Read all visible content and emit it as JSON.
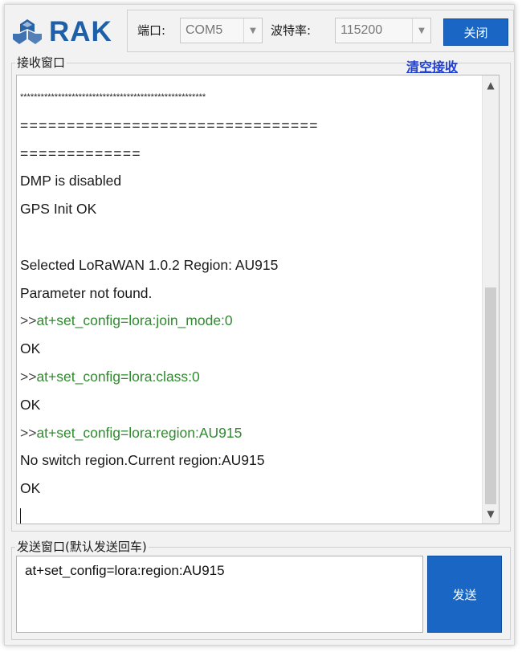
{
  "header": {
    "logo_text": "RAK",
    "port_label": "端口:",
    "port_value": "COM5",
    "baud_label": "波特率:",
    "baud_value": "115200",
    "close_button": "关闭"
  },
  "receive": {
    "group_label": "接收窗口",
    "clear_link": "清空接收",
    "lines": [
      {
        "type": "stars",
        "text": "******************************************************"
      },
      {
        "type": "eq",
        "text": "================================"
      },
      {
        "type": "eq",
        "text": "============="
      },
      {
        "type": "plain",
        "text": "DMP is disabled"
      },
      {
        "type": "plain",
        "text": "GPS Init OK"
      },
      {
        "type": "plain",
        "text": ""
      },
      {
        "type": "plain",
        "text": "Selected LoRaWAN 1.0.2 Region: AU915"
      },
      {
        "type": "plain",
        "text": "Parameter not found."
      },
      {
        "type": "cmd",
        "prefix": ">>",
        "text": "at+set_config=lora:join_mode:0"
      },
      {
        "type": "plain",
        "text": "OK"
      },
      {
        "type": "cmd",
        "prefix": ">>",
        "text": "at+set_config=lora:class:0"
      },
      {
        "type": "plain",
        "text": "OK"
      },
      {
        "type": "cmd",
        "prefix": ">>",
        "text": "at+set_config=lora:region:AU915"
      },
      {
        "type": "plain",
        "text": "No switch region.Current region:AU915"
      },
      {
        "type": "plain",
        "text": "OK"
      }
    ]
  },
  "send": {
    "group_label": "发送窗口(默认发送回车)",
    "input_value": "at+set_config=lora:region:AU915",
    "send_button": "发送"
  },
  "colors": {
    "accent": "#1966c4",
    "logo": "#1d5fa8",
    "command": "#2e8b2e",
    "link": "#1f3fd6"
  }
}
